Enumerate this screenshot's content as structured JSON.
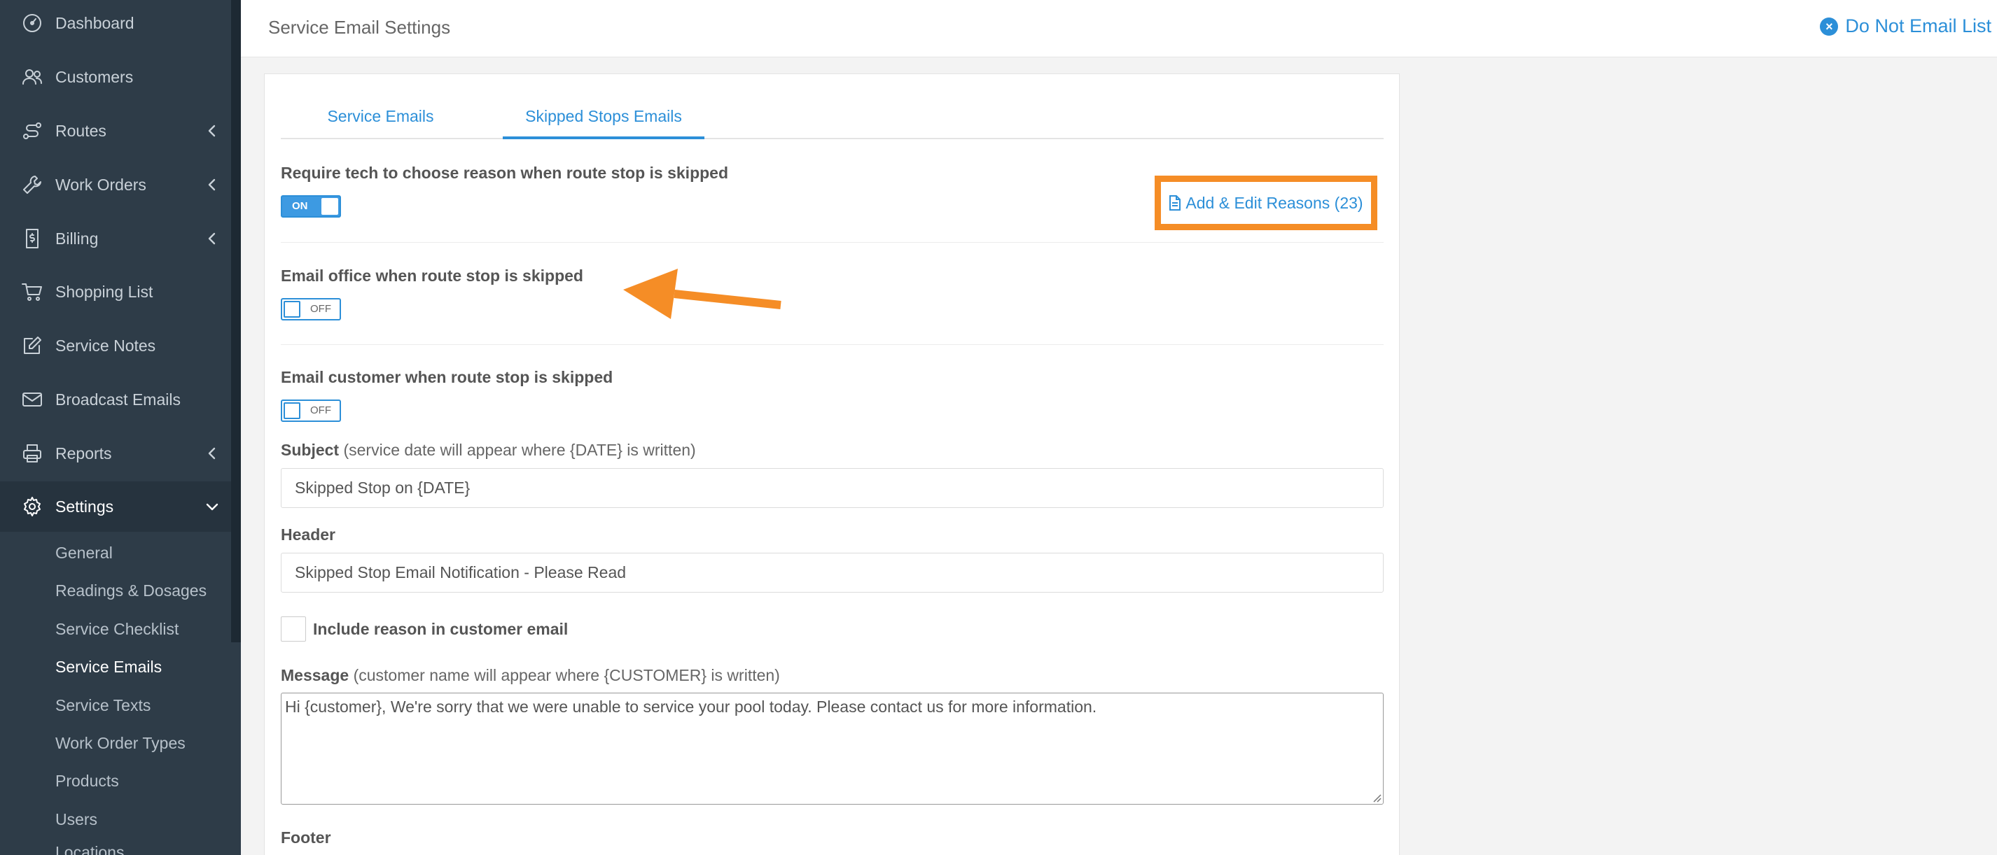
{
  "sidebar": {
    "items": [
      {
        "label": "Dashboard",
        "icon": "dashboard-icon"
      },
      {
        "label": "Customers",
        "icon": "users-icon"
      },
      {
        "label": "Routes",
        "icon": "route-icon"
      },
      {
        "label": "Work Orders",
        "icon": "wrench-icon"
      },
      {
        "label": "Billing",
        "icon": "invoice-icon"
      },
      {
        "label": "Shopping List",
        "icon": "cart-icon"
      },
      {
        "label": "Service Notes",
        "icon": "edit-icon"
      },
      {
        "label": "Broadcast Emails",
        "icon": "envelope-icon"
      },
      {
        "label": "Reports",
        "icon": "printer-icon"
      },
      {
        "label": "Settings",
        "icon": "gear-icon"
      }
    ],
    "settings_sub": [
      "General",
      "Readings & Dosages",
      "Service Checklist",
      "Service Emails",
      "Service Texts",
      "Work Order Types",
      "Products",
      "Users",
      "Locations"
    ]
  },
  "header": {
    "title": "Service Email Settings",
    "do_not_email": "Do Not Email List"
  },
  "tabs": [
    "Service Emails",
    "Skipped Stops Emails"
  ],
  "form": {
    "require_reason": {
      "label": "Require tech to choose reason when route stop is skipped",
      "state": "ON"
    },
    "add_edit_reasons": "Add & Edit Reasons (23)",
    "email_office": {
      "label": "Email office when route stop is skipped",
      "state": "OFF"
    },
    "email_customer": {
      "label": "Email customer when route stop is skipped",
      "state": "OFF"
    },
    "subject": {
      "label": "Subject",
      "hint": "(service date will appear where {DATE} is written)",
      "value": "Skipped Stop on {DATE}"
    },
    "header": {
      "label": "Header",
      "value": "Skipped Stop Email Notification - Please Read"
    },
    "include_reason": "Include reason in customer email",
    "message": {
      "label": "Message",
      "hint": "(customer name will appear where {CUSTOMER} is written)",
      "value": "Hi {customer}, We're sorry that we were unable to service your pool today. Please contact us for more information."
    },
    "footer": {
      "label": "Footer"
    }
  },
  "colors": {
    "accent": "#2c8fd8",
    "highlight": "#f58d26",
    "sidebar": "#2e3c48"
  }
}
